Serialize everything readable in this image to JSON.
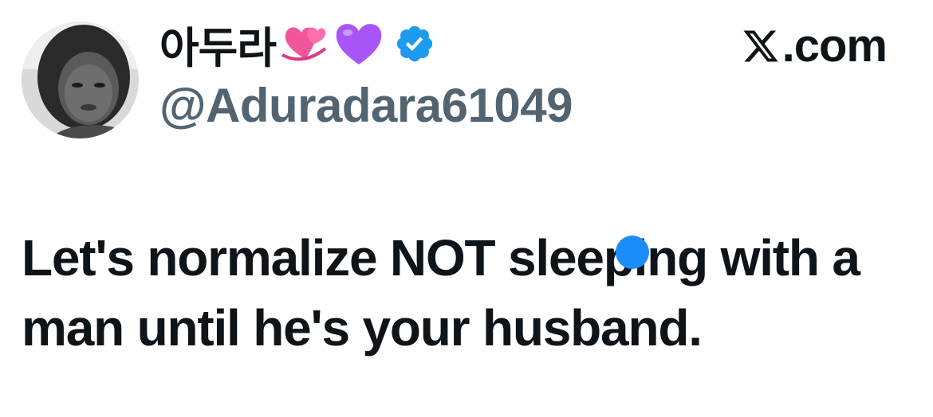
{
  "user": {
    "display_name": "아두라",
    "handle": "@Aduradara61049",
    "name_emojis": [
      "revolving-hearts-emoji",
      "purple-heart-emoji"
    ],
    "verified_icon": "verified-badge-icon",
    "avatar_icon": "profile-photo"
  },
  "brand": {
    "icon": "x-logo-icon",
    "domain": ".com"
  },
  "tweet": {
    "text": "Let's normalize NOT sleeping with a man until he's your husband."
  },
  "colors": {
    "text": "#0f1419",
    "handle": "#536471",
    "verified": "#1d9bf0",
    "touch_dot": "#1d8cf8",
    "purple_heart": "#a855f7",
    "pink_heart": "#ec4899"
  }
}
